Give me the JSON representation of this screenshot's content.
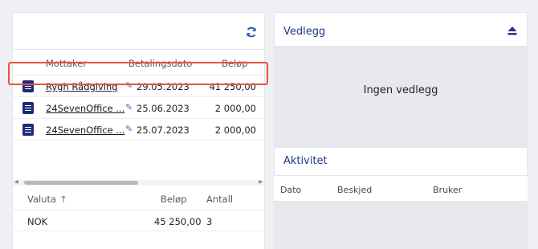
{
  "payments": {
    "columns": {
      "recipient": "Mottaker",
      "date": "Betalingsdato",
      "amount": "Beløp"
    },
    "rows": [
      {
        "recipient": "Rygh Rådgiving",
        "date": "29.05.2023",
        "amount": "41 250,00"
      },
      {
        "recipient": "24SevenOffice ...",
        "date": "25.06.2023",
        "amount": "2 000,00"
      },
      {
        "recipient": "24SevenOffice ...",
        "date": "25.07.2023",
        "amount": "2 000,00"
      }
    ]
  },
  "summary": {
    "columns": {
      "currency": "Valuta",
      "amount": "Beløp",
      "count": "Antall"
    },
    "rows": [
      {
        "currency": "NOK",
        "amount": "45 250,00",
        "count": "3"
      }
    ]
  },
  "attachments": {
    "title": "Vedlegg",
    "empty_text": "Ingen vedlegg"
  },
  "activity": {
    "title": "Aktivitet",
    "columns": {
      "date": "Dato",
      "message": "Beskjed",
      "user": "Bruker"
    }
  },
  "icons": {
    "refresh": "refresh-icon",
    "eject": "eject-icon",
    "document": "document-icon",
    "edit": "edit-icon",
    "sort": "sort-up-icon"
  },
  "colors": {
    "highlight": "#e8553b",
    "accent": "#1f3a86",
    "icon": "#1c2a7a"
  }
}
